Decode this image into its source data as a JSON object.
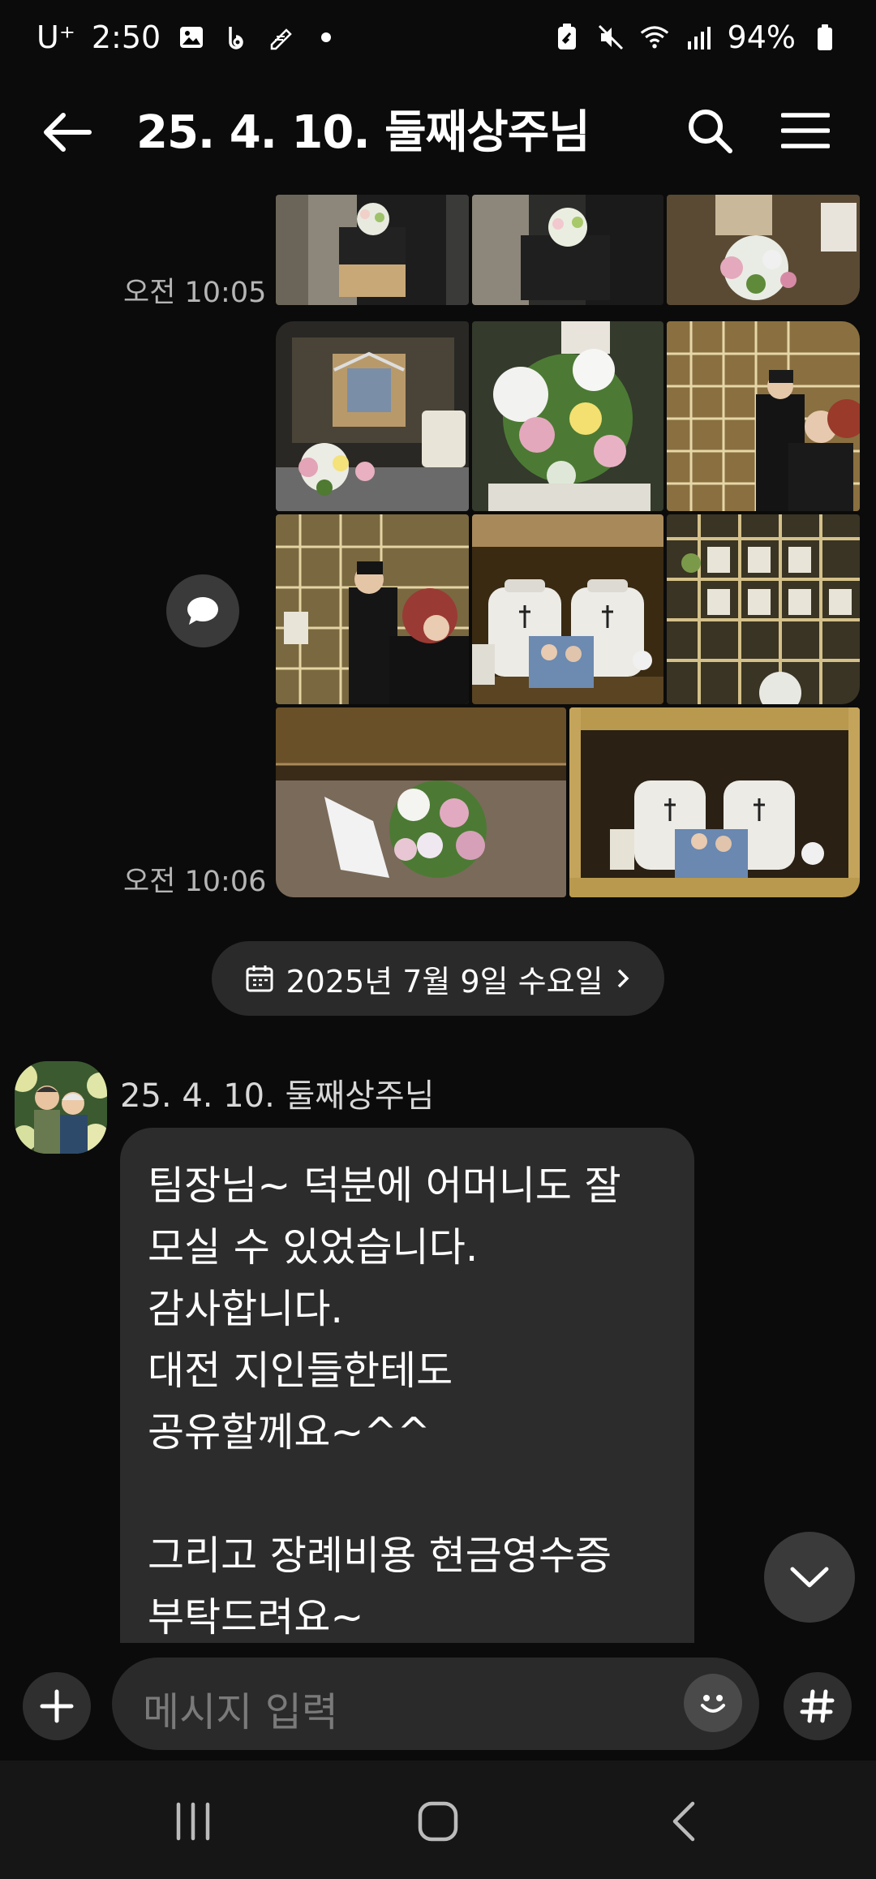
{
  "status_bar": {
    "carrier": "U⁺",
    "time": "2:50",
    "battery": "94%"
  },
  "header": {
    "title": "25. 4. 10. 둘째상주님",
    "back_icon": "arrow-left-icon",
    "search_icon": "search-icon",
    "menu_icon": "menu-icon"
  },
  "chat": {
    "timestamps": [
      "오전 10:05",
      "오전 10:06"
    ],
    "photo_album_count": 11,
    "date_divider": "2025년 7월 9일 수요일",
    "sender": "25. 4. 10. 둘째상주님",
    "message_lines": [
      "팀장님~ 덕분에 어머니도 잘",
      "모실 수 있었습니다.",
      "감사합니다.",
      "대전 지인들한테도",
      "공유할께요~^^",
      "",
      "그리고 장례비용 현금영수증",
      "부탁드려요~"
    ]
  },
  "input": {
    "placeholder": "메시지 입력"
  },
  "colors": {
    "background": "#0b0b0b",
    "bubble": "#2c2c2c",
    "pill": "#2a2a2a"
  }
}
